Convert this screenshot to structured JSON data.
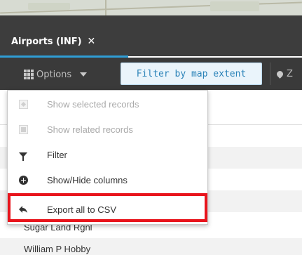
{
  "tab": {
    "label": "Airports (INF)",
    "close_symbol": "✕"
  },
  "toolbar": {
    "options_label": "Options",
    "filter_label": "Filter by map extent",
    "zoom_label": "Z"
  },
  "menu": {
    "items": [
      {
        "label": "Show selected records",
        "icon": "show-selected-icon",
        "enabled": false
      },
      {
        "label": "Show related records",
        "icon": "show-related-icon",
        "enabled": false
      },
      {
        "label": "Filter",
        "icon": "funnel-icon",
        "enabled": true
      },
      {
        "label": "Show/Hide columns",
        "icon": "plus-circle-icon",
        "enabled": true
      },
      {
        "label": "Export all to CSV",
        "icon": "export-arrow-icon",
        "enabled": true
      }
    ]
  },
  "table": {
    "rows": [
      "Sugar Land Rgnl",
      "William P Hobby"
    ]
  },
  "colors": {
    "accent": "#2f9ed6",
    "highlight": "#e8141c",
    "header_bg": "#3d3d3d"
  }
}
